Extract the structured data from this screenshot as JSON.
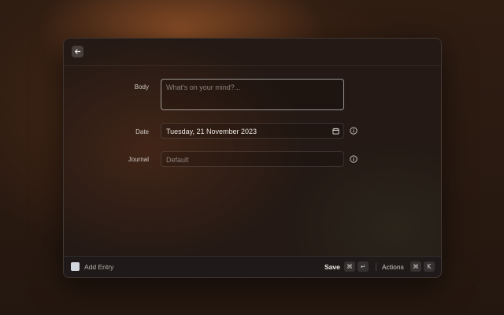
{
  "form": {
    "body": {
      "label": "Body",
      "placeholder": "What's on your mind?..."
    },
    "date": {
      "label": "Date",
      "value": "Tuesday, 21 November 2023",
      "picker_icon": "calendar-icon",
      "info_icon": "info-icon"
    },
    "journal": {
      "label": "Journal",
      "placeholder": "Default",
      "info_icon": "info-icon"
    }
  },
  "toolbar": {
    "back_icon": "arrow-left-icon"
  },
  "footer": {
    "title": "Add Entry",
    "primary_action": "Save",
    "primary_shortcut": [
      "⌘",
      "↵"
    ],
    "actions_label": "Actions",
    "actions_shortcut": [
      "⌘",
      "K"
    ]
  },
  "colors": {
    "accent_glow": "#c46e34",
    "window_bg": "#241914",
    "focus_border": "#e9e4df"
  }
}
